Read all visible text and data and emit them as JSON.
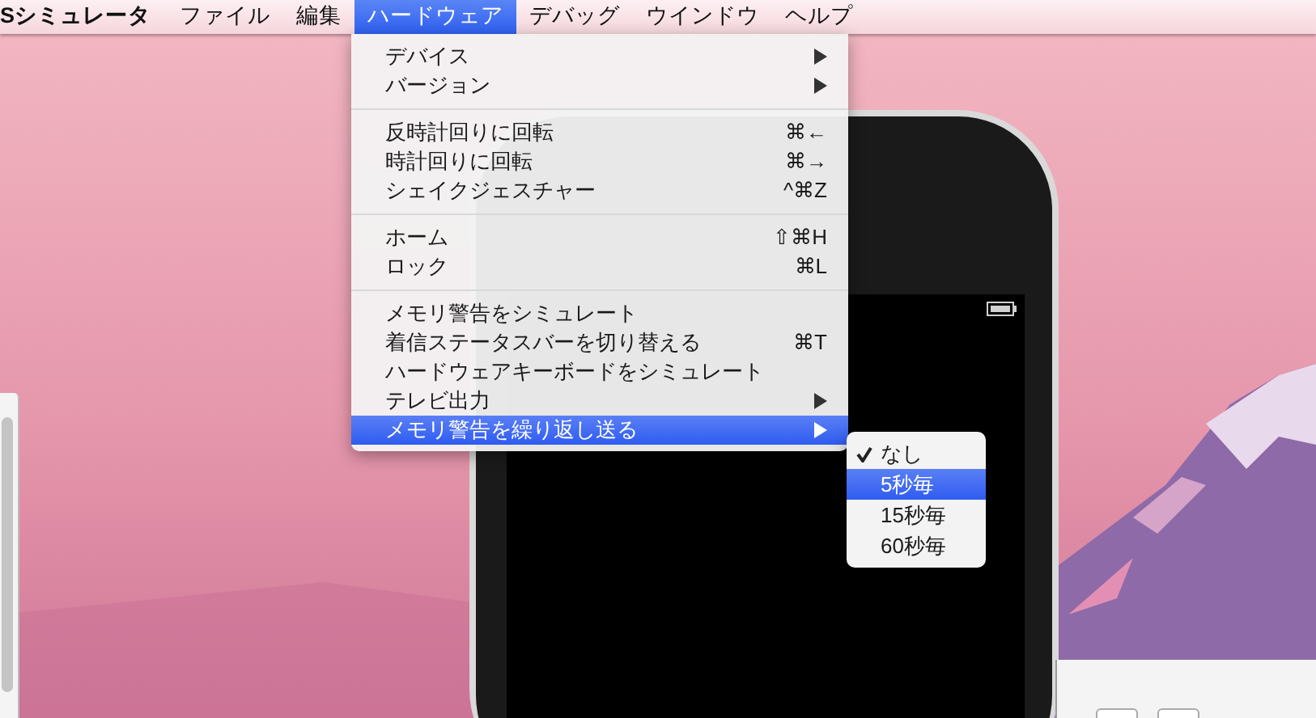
{
  "menu_bar": {
    "app_name": "Sシミュレータ",
    "menus": [
      {
        "label": "ファイル",
        "selected": false
      },
      {
        "label": "編集",
        "selected": false
      },
      {
        "label": "ハードウェア",
        "selected": true
      },
      {
        "label": "デバッグ",
        "selected": false
      },
      {
        "label": "ウインドウ",
        "selected": false
      },
      {
        "label": "ヘルプ",
        "selected": false
      }
    ]
  },
  "menu": {
    "sections": [
      [
        {
          "label": "デバイス",
          "submenu": true,
          "selected": false
        },
        {
          "label": "バージョン",
          "submenu": true,
          "selected": false
        }
      ],
      [
        {
          "label": "反時計回りに回転",
          "shortcut": "⌘←",
          "submenu": false,
          "selected": false
        },
        {
          "label": "時計回りに回転",
          "shortcut": "⌘→",
          "submenu": false,
          "selected": false
        },
        {
          "label": "シェイクジェスチャー",
          "shortcut": "^⌘Z",
          "submenu": false,
          "selected": false
        }
      ],
      [
        {
          "label": "ホーム",
          "shortcut": "⇧⌘H",
          "submenu": false,
          "selected": false
        },
        {
          "label": "ロック",
          "shortcut": "⌘L",
          "submenu": false,
          "selected": false
        }
      ],
      [
        {
          "label": "メモリ警告をシミュレート",
          "submenu": false,
          "selected": false
        },
        {
          "label": "着信ステータスバーを切り替える",
          "shortcut": "⌘T",
          "submenu": false,
          "selected": false
        },
        {
          "label": "ハードウェアキーボードをシミュレート",
          "submenu": false,
          "selected": false
        },
        {
          "label": "テレビ出力",
          "submenu": true,
          "selected": false
        },
        {
          "label": "メモリ警告を繰り返し送る",
          "submenu": true,
          "selected": true
        }
      ]
    ]
  },
  "submenu": {
    "items": [
      {
        "label": "なし",
        "checked": true,
        "selected": false
      },
      {
        "label": "5秒毎",
        "checked": false,
        "selected": true
      },
      {
        "label": "15秒毎",
        "checked": false,
        "selected": false
      },
      {
        "label": "60秒毎",
        "checked": false,
        "selected": false
      }
    ]
  }
}
